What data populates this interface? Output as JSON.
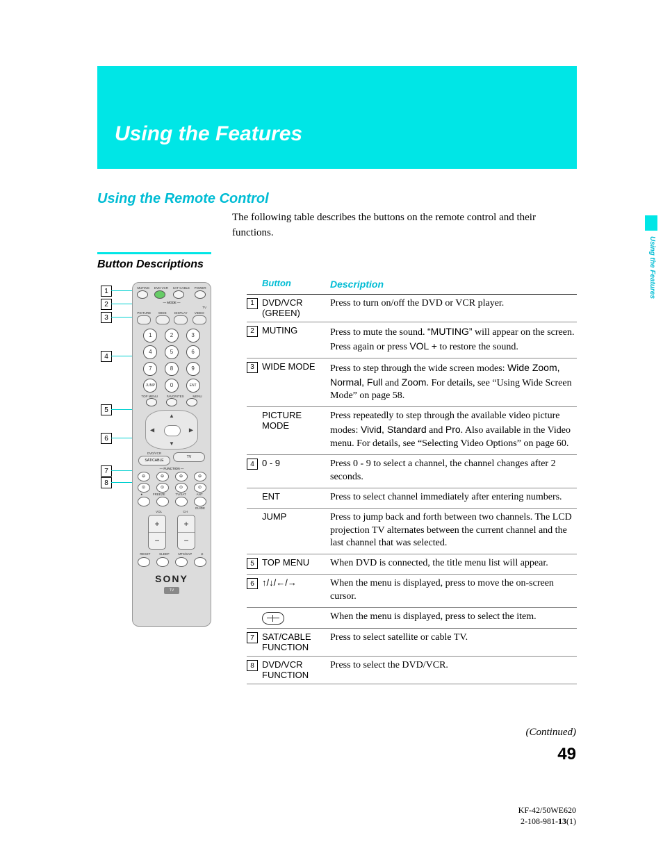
{
  "header": {
    "title": "Using the Features"
  },
  "section": {
    "title": "Using the Remote Control"
  },
  "intro": "The following table describes the buttons on the remote control and their functions.",
  "subhead": "Button Descriptions",
  "side_tab": "Using the Features",
  "table": {
    "head_button": "Button",
    "head_desc": "Description",
    "rows": [
      {
        "num": "1",
        "btn": "DVD/VCR (GREEN)",
        "desc": "Press to turn on/off the DVD or VCR player."
      },
      {
        "num": "2",
        "btn": "MUTING",
        "desc_html": "Press to mute the sound. <span class='desc-sans'>“MUTING”</span> will appear on the screen. Press again or press <span class='desc-sans'>VOL +</span> to restore the sound."
      },
      {
        "num": "3",
        "btn": "WIDE MODE",
        "desc_html": "Press to step through the wide screen modes: <span class='desc-sans'>Wide Zoom, Normal, Full</span> and <span class='desc-sans'>Zoom</span>. For details, see “Using Wide Screen Mode” on page 58."
      },
      {
        "num": "",
        "btn": "PICTURE MODE",
        "desc_html": "Press repeatedly to step through the available video picture modes: <span class='desc-sans'>Vivid, Standard</span> and <span class='desc-sans'>Pro</span>. Also available in the Video menu. For details, see “Selecting Video Options” on page 60."
      },
      {
        "num": "4",
        "btn": "0 - 9",
        "desc": "Press 0 - 9 to select a channel, the channel changes after 2 seconds."
      },
      {
        "num": "",
        "btn": "ENT",
        "desc": "Press to select channel immediately after entering numbers."
      },
      {
        "num": "",
        "btn": "JUMP",
        "desc": "Press to jump back and forth between two channels. The LCD projection TV alternates between the current channel and the last channel that was selected."
      },
      {
        "num": "5",
        "btn": "TOP MENU",
        "desc": "When DVD is connected, the title menu list will appear."
      },
      {
        "num": "6",
        "btn": "↑/↓/←/→",
        "desc": "When the menu is displayed, press to move the on-screen cursor."
      },
      {
        "num": "",
        "btn": "__select_icon__",
        "desc": "When the menu is displayed, press to select the item."
      },
      {
        "num": "7",
        "btn": "SAT/CABLE FUNCTION",
        "desc": "Press to select satellite or cable TV."
      },
      {
        "num": "8",
        "btn": "DVD/VCR FUNCTION",
        "desc": "Press to select the DVD/VCR."
      }
    ]
  },
  "callouts": [
    "1",
    "2",
    "3",
    "4",
    "5",
    "6",
    "7",
    "8"
  ],
  "remote": {
    "top_labels": [
      "MUTING",
      "DVD VCR",
      "SAT CABLE",
      "POWER"
    ],
    "mode_label": "MODE",
    "row2_labels": [
      "PICTURE",
      "WIDE",
      "DISPLAY",
      "VIDEO"
    ],
    "tv_label": "TV",
    "numpad": [
      "1",
      "2",
      "3",
      "4",
      "5",
      "6",
      "7",
      "8",
      "9",
      "0"
    ],
    "jump": "JUMP",
    "ent": "ENT",
    "menu_row": [
      "TOP MENU",
      "FAVORITES",
      "MENU"
    ],
    "pills": [
      "SAT/CABLE",
      "TV"
    ],
    "dvdvcr": "DVD/VCR",
    "function_label": "FUNCTION",
    "transport1": [
      "⊖",
      "⊖",
      "⊖",
      "⊖"
    ],
    "transport2": [
      "⊙",
      "⊙",
      "⊙",
      "⊙"
    ],
    "bottom_labels": [
      "FREEZE",
      "TV/SAT",
      "ANT"
    ],
    "guide": "GUIDE",
    "vol": "VOL",
    "ch": "CH",
    "reset_row": [
      "RESET",
      "SLEEP",
      "MTS/SAP",
      ""
    ],
    "brand": "SONY",
    "tv_tag": "TV"
  },
  "continued": "(Continued)",
  "page_num": "49",
  "footer": {
    "l1": "KF-42/50WE620",
    "l2_a": "2-108-981-",
    "l2_b": "13",
    "l2_c": "(1)"
  }
}
